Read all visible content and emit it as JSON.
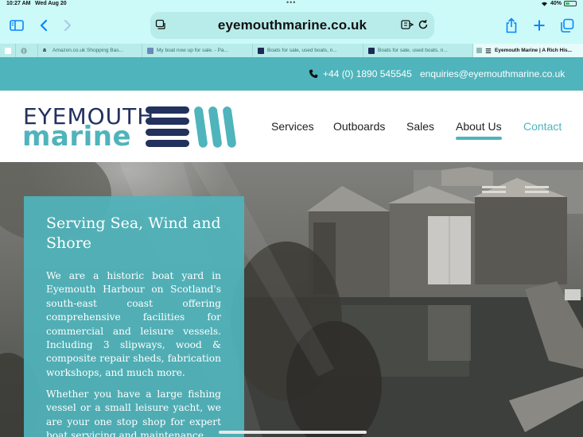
{
  "status": {
    "time": "10:27 AM",
    "date": "Wed Aug 20",
    "battery": "40%",
    "battery_level": 0.4
  },
  "browser": {
    "domain": "eyemouthmarine.co.uk",
    "tabs": [
      {
        "label": "",
        "icon": "page-icon"
      },
      {
        "label": "",
        "icon": "globe-icon"
      },
      {
        "label": "Amazon.co.uk Shopping Bas...",
        "icon": "amazon-icon"
      },
      {
        "label": "My boat now up for sale. - Pa...",
        "icon": "forum-icon"
      },
      {
        "label": "Boats for sale, used boats, n...",
        "icon": "boats-icon"
      },
      {
        "label": "Boats for sale, used boats, n...",
        "icon": "boats-icon"
      },
      {
        "label": "Eyemouth Marine | A Rich His...",
        "icon": "menu-icon"
      }
    ]
  },
  "site": {
    "phone": "+44 (0) 1890 545545",
    "email": "enquiries@eyemouthmarine.co.uk",
    "logo_line1": "EYEMOUTH",
    "logo_line2": "marine",
    "nav": [
      "Services",
      "Outboards",
      "Sales",
      "About Us",
      "Contact"
    ],
    "active_nav": "About Us",
    "colors": {
      "teal": "#4fb4bc",
      "navy": "#22315e"
    },
    "hero": {
      "title": "Serving Sea, Wind and Shore",
      "para1": "We are a historic boat yard in Eyemouth Harbour on Scotland's south-east coast offering comprehensive facilities for commercial and leisure vessels. Including 3 slipways, wood & composite repair sheds, fabrication workshops, and much more.",
      "para2": "Whether you have a large fishing vessel or a small leisure yacht, we are your one stop shop for expert boat servicing and maintenance."
    }
  }
}
